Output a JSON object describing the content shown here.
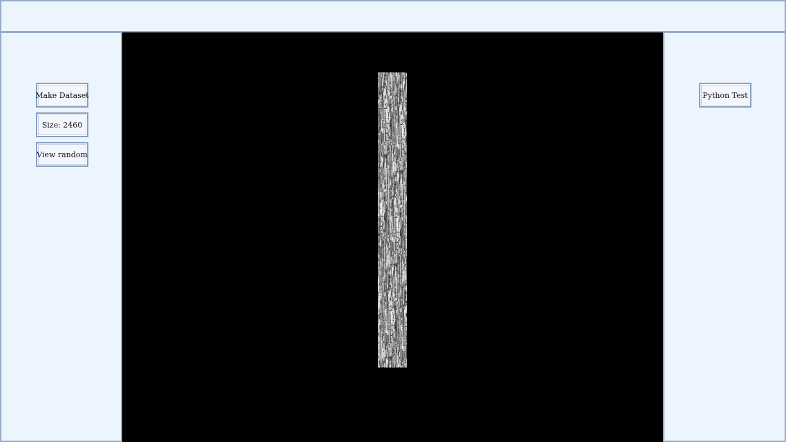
{
  "left_panel": {
    "buttons": {
      "make_dataset": "Make Dataset",
      "size": "Size: 2460",
      "view_random": "View random"
    }
  },
  "right_panel": {
    "buttons": {
      "python_test": "Python Test"
    }
  },
  "canvas": {
    "background": "#000000",
    "image": "grayscale-noise-strip"
  },
  "colors": {
    "panel_bg": "#ecf4fe",
    "panel_border": "#97acc7"
  }
}
